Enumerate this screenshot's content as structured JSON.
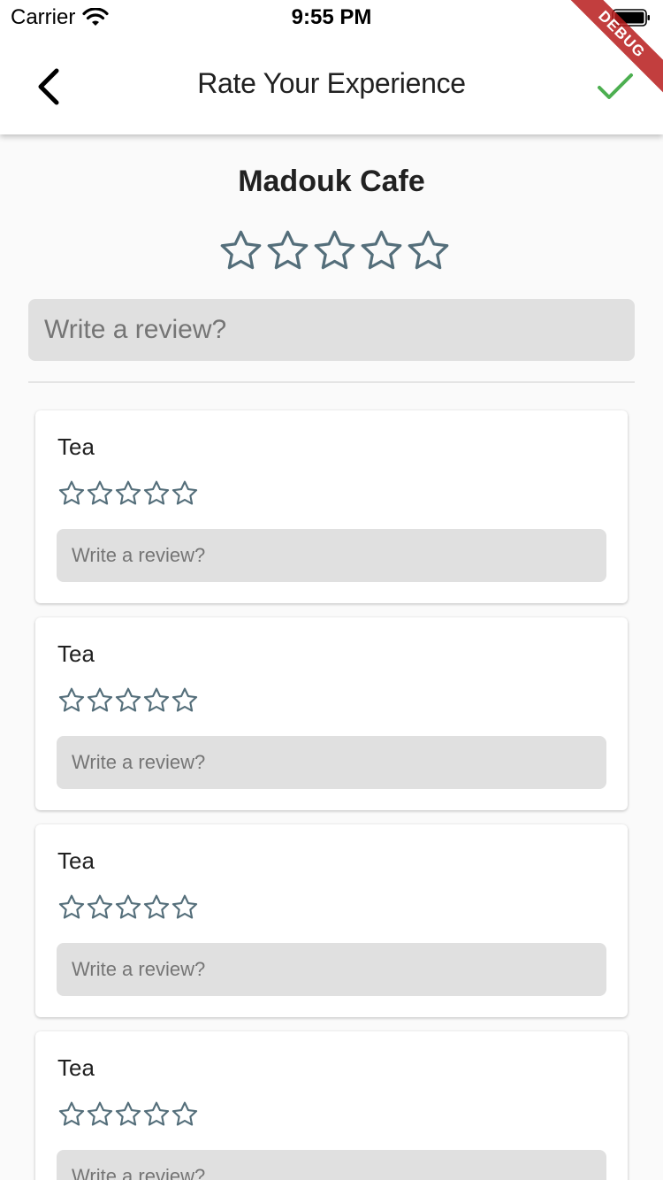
{
  "status_bar": {
    "carrier": "Carrier",
    "time": "9:55 PM"
  },
  "app_bar": {
    "title": "Rate Your Experience",
    "back_icon": "chevron-left-icon",
    "done_icon": "check-icon",
    "done_color": "#4caf50"
  },
  "debug_banner": "DEBUG",
  "place": {
    "name": "Madouk Cafe",
    "rating": 0,
    "max_rating": 5,
    "review_placeholder": "Write a review?",
    "review_value": ""
  },
  "star_color": "#546e7a",
  "items": [
    {
      "name": "Tea",
      "rating": 0,
      "review_placeholder": "Write a review?",
      "review_value": ""
    },
    {
      "name": "Tea",
      "rating": 0,
      "review_placeholder": "Write a review?",
      "review_value": ""
    },
    {
      "name": "Tea",
      "rating": 0,
      "review_placeholder": "Write a review?",
      "review_value": ""
    },
    {
      "name": "Tea",
      "rating": 0,
      "review_placeholder": "Write a review?",
      "review_value": ""
    }
  ]
}
